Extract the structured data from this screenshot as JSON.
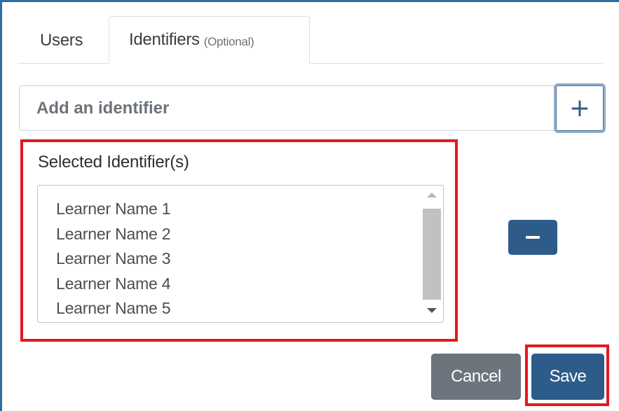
{
  "tabs": {
    "users_label": "Users",
    "identifiers_label": "Identifiers",
    "identifiers_optional": "(Optional)"
  },
  "add_identifier": {
    "placeholder": "Add an identifier",
    "value": "",
    "add_button_label": "+"
  },
  "selected": {
    "label": "Selected Identifier(s)",
    "items": [
      "Learner Name 1",
      "Learner Name 2",
      "Learner Name 3",
      "Learner Name 4",
      "Learner Name 5"
    ]
  },
  "remove_button": {
    "icon": "minus-icon"
  },
  "footer": {
    "cancel_label": "Cancel",
    "save_label": "Save"
  },
  "colors": {
    "primary": "#2e5c8a",
    "secondary": "#6c757d",
    "highlight": "#e4191f",
    "frame": "#2e6da4"
  }
}
